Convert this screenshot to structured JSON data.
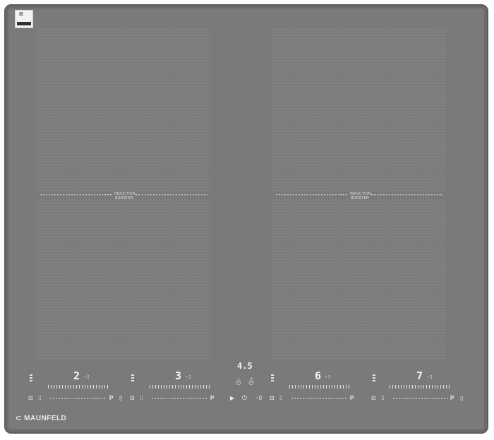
{
  "brand": {
    "name": "MAUNFELD"
  },
  "timer": {
    "display": "4.5",
    "minus": "−",
    "plus": "+"
  },
  "zones": [
    {
      "id": "front-left",
      "level": "2"
    },
    {
      "id": "back-left",
      "level": "3"
    },
    {
      "id": "front-right",
      "level": "6"
    },
    {
      "id": "back-right",
      "level": "7"
    }
  ],
  "booster": {
    "line1": "INDUCTION",
    "line2": "BOOSTER"
  },
  "power_label": "P",
  "lock_label": "−0",
  "colors": {
    "glass": "#7a7a7a",
    "frame": "#747474",
    "display": "#f4f4f4"
  }
}
